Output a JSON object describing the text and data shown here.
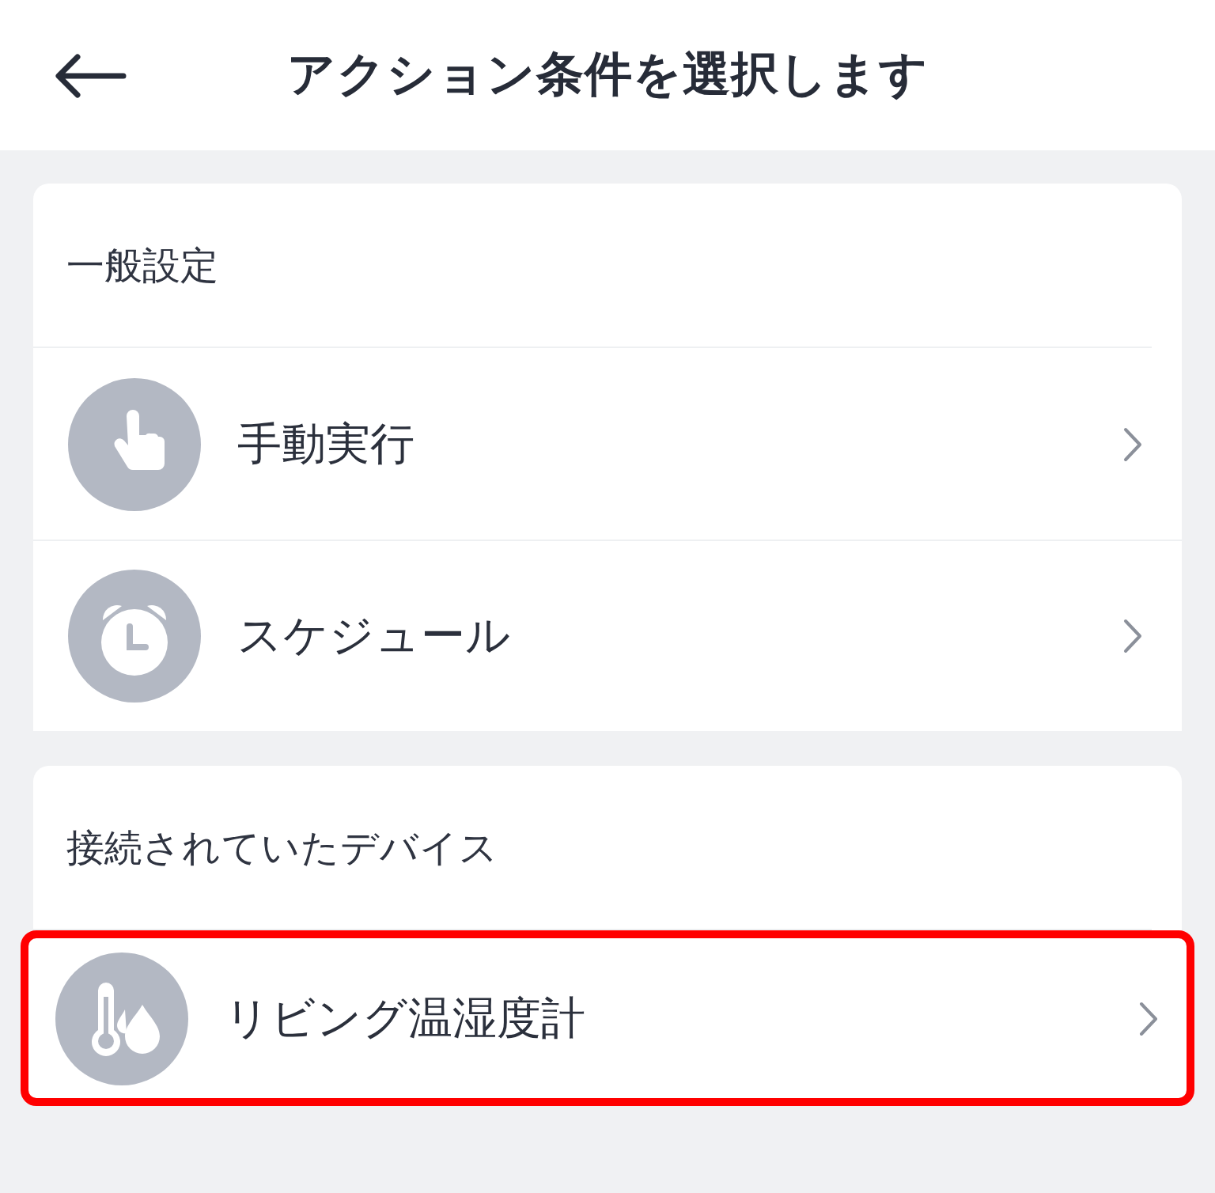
{
  "header": {
    "title": "アクション条件を選択します"
  },
  "sections": [
    {
      "title": "一般設定",
      "items": [
        {
          "label": "手動実行",
          "kind": "manual",
          "highlighted": false
        },
        {
          "label": "スケジュール",
          "kind": "schedule",
          "highlighted": false
        }
      ]
    },
    {
      "title": "接続されていたデバイス",
      "items": [
        {
          "label": "リビング温湿度計",
          "kind": "thermohygrometer",
          "highlighted": true
        }
      ]
    }
  ]
}
